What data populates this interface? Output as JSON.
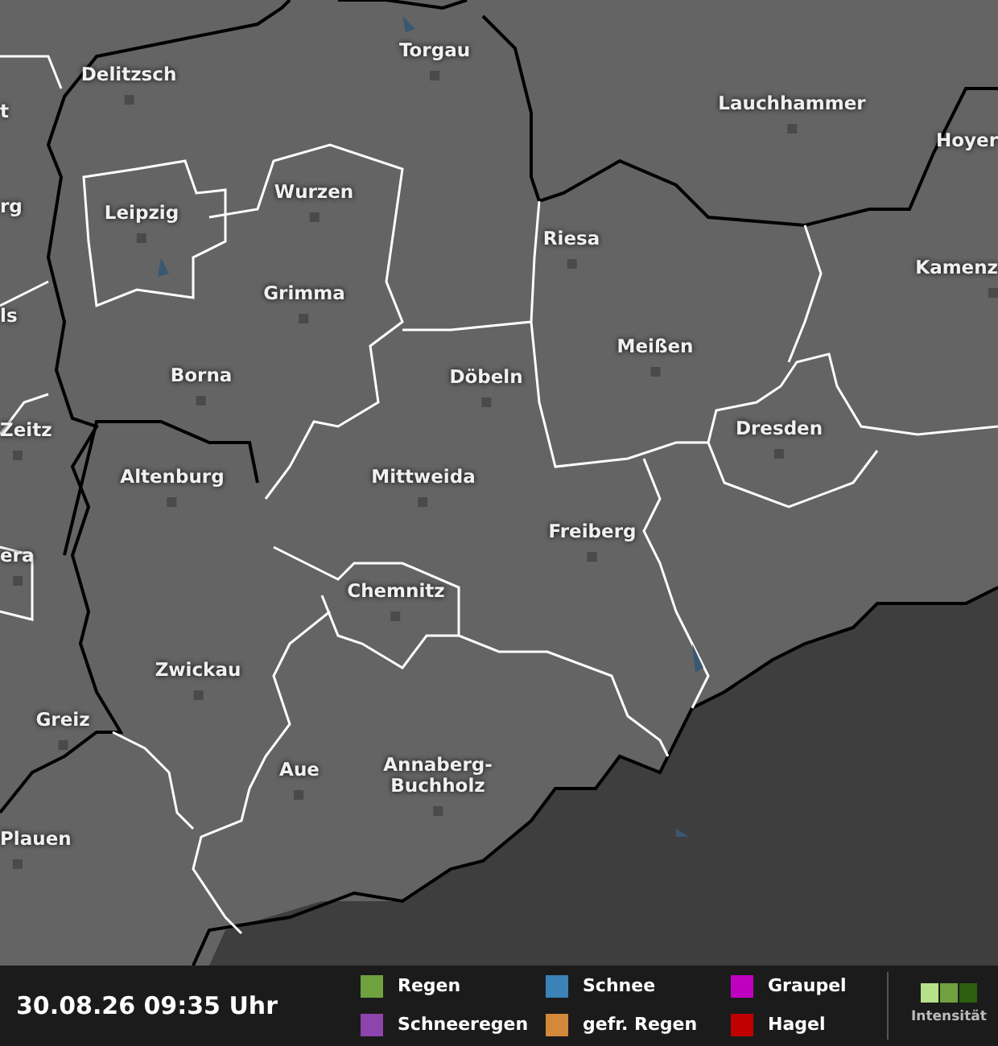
{
  "map": {
    "places": [
      {
        "name": "Torgau",
        "kind": "city"
      },
      {
        "name": "Delitzsch",
        "kind": "city"
      },
      {
        "name": "Lauchhammer",
        "kind": "city"
      },
      {
        "name": "Hoyer",
        "kind": "fragment"
      },
      {
        "name": "t",
        "kind": "fragment"
      },
      {
        "name": "rg",
        "kind": "fragment"
      },
      {
        "name": "Leipzig",
        "kind": "city"
      },
      {
        "name": "Wurzen",
        "kind": "city"
      },
      {
        "name": "Riesa",
        "kind": "city"
      },
      {
        "name": "Kamenz",
        "kind": "city"
      },
      {
        "name": "Grimma",
        "kind": "city"
      },
      {
        "name": "ls",
        "kind": "fragment"
      },
      {
        "name": "Meißen",
        "kind": "city"
      },
      {
        "name": "Döbeln",
        "kind": "city"
      },
      {
        "name": "Borna",
        "kind": "city"
      },
      {
        "name": "Dresden",
        "kind": "city"
      },
      {
        "name": "Zeitz",
        "kind": "city"
      },
      {
        "name": "Altenburg",
        "kind": "city"
      },
      {
        "name": "Mittweida",
        "kind": "city"
      },
      {
        "name": "Freiberg",
        "kind": "city"
      },
      {
        "name": "era",
        "kind": "city"
      },
      {
        "name": "Chemnitz",
        "kind": "city"
      },
      {
        "name": "Zwickau",
        "kind": "city"
      },
      {
        "name": "Greiz",
        "kind": "city"
      },
      {
        "name": "Aue",
        "kind": "city"
      },
      {
        "name": "Annaberg-\nBuchholz",
        "kind": "city"
      },
      {
        "name": "Plauen",
        "kind": "city"
      }
    ]
  },
  "footer": {
    "timestamp": "30.08.26 09:35 Uhr",
    "legend": [
      {
        "label": "Regen",
        "color": "#6fa13f"
      },
      {
        "label": "Schneeregen",
        "color": "#8e44ad"
      },
      {
        "label": "Schnee",
        "color": "#3b82b8"
      },
      {
        "label": "gefr. Regen",
        "color": "#d4883a"
      },
      {
        "label": "Graupel",
        "color": "#c000c0"
      },
      {
        "label": "Hagel",
        "color": "#c00000"
      }
    ],
    "intensity": {
      "label": "Intensität"
    }
  }
}
